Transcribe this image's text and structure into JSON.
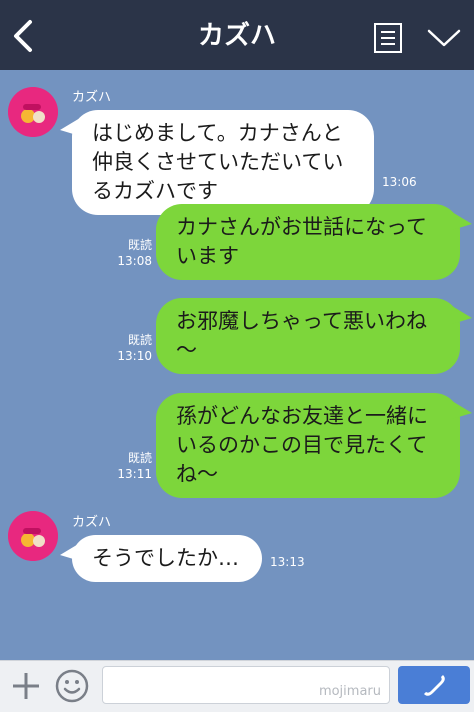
{
  "header": {
    "title": "カズハ"
  },
  "messages": [
    {
      "sender": "カズハ",
      "text_lines": [
        "はじめまして。カナさんと",
        "仲良くさせていただいてい",
        "るカズハです"
      ],
      "time": "13:06"
    },
    {
      "text_lines": [
        "カナさんがお世話になって",
        "います"
      ],
      "read": "既読",
      "time": "13:08"
    },
    {
      "text_lines": [
        "お邪魔しちゃって悪いわね",
        "〜"
      ],
      "read": "既読",
      "time": "13:10"
    },
    {
      "text_lines": [
        "孫がどんなお友達と一緒に",
        "いるのかこの目で見たくて",
        "ね〜"
      ],
      "read": "既読",
      "time": "13:11"
    },
    {
      "sender": "カズハ",
      "text_lines": [
        "そうでしたか…"
      ],
      "time": "13:13"
    }
  ],
  "footer": {
    "watermark": "mojimaru"
  },
  "colors": {
    "header_bg": "#2b3448",
    "chat_bg": "#7393c0",
    "sent_bubble": "#7dd63b",
    "received_bubble": "#ffffff",
    "call_button": "#4a7ed6"
  },
  "icons": [
    "back-arrow-icon",
    "menu-list-icon",
    "chevron-down-icon",
    "avatar",
    "plus-icon",
    "smiley-icon",
    "phone-icon"
  ]
}
